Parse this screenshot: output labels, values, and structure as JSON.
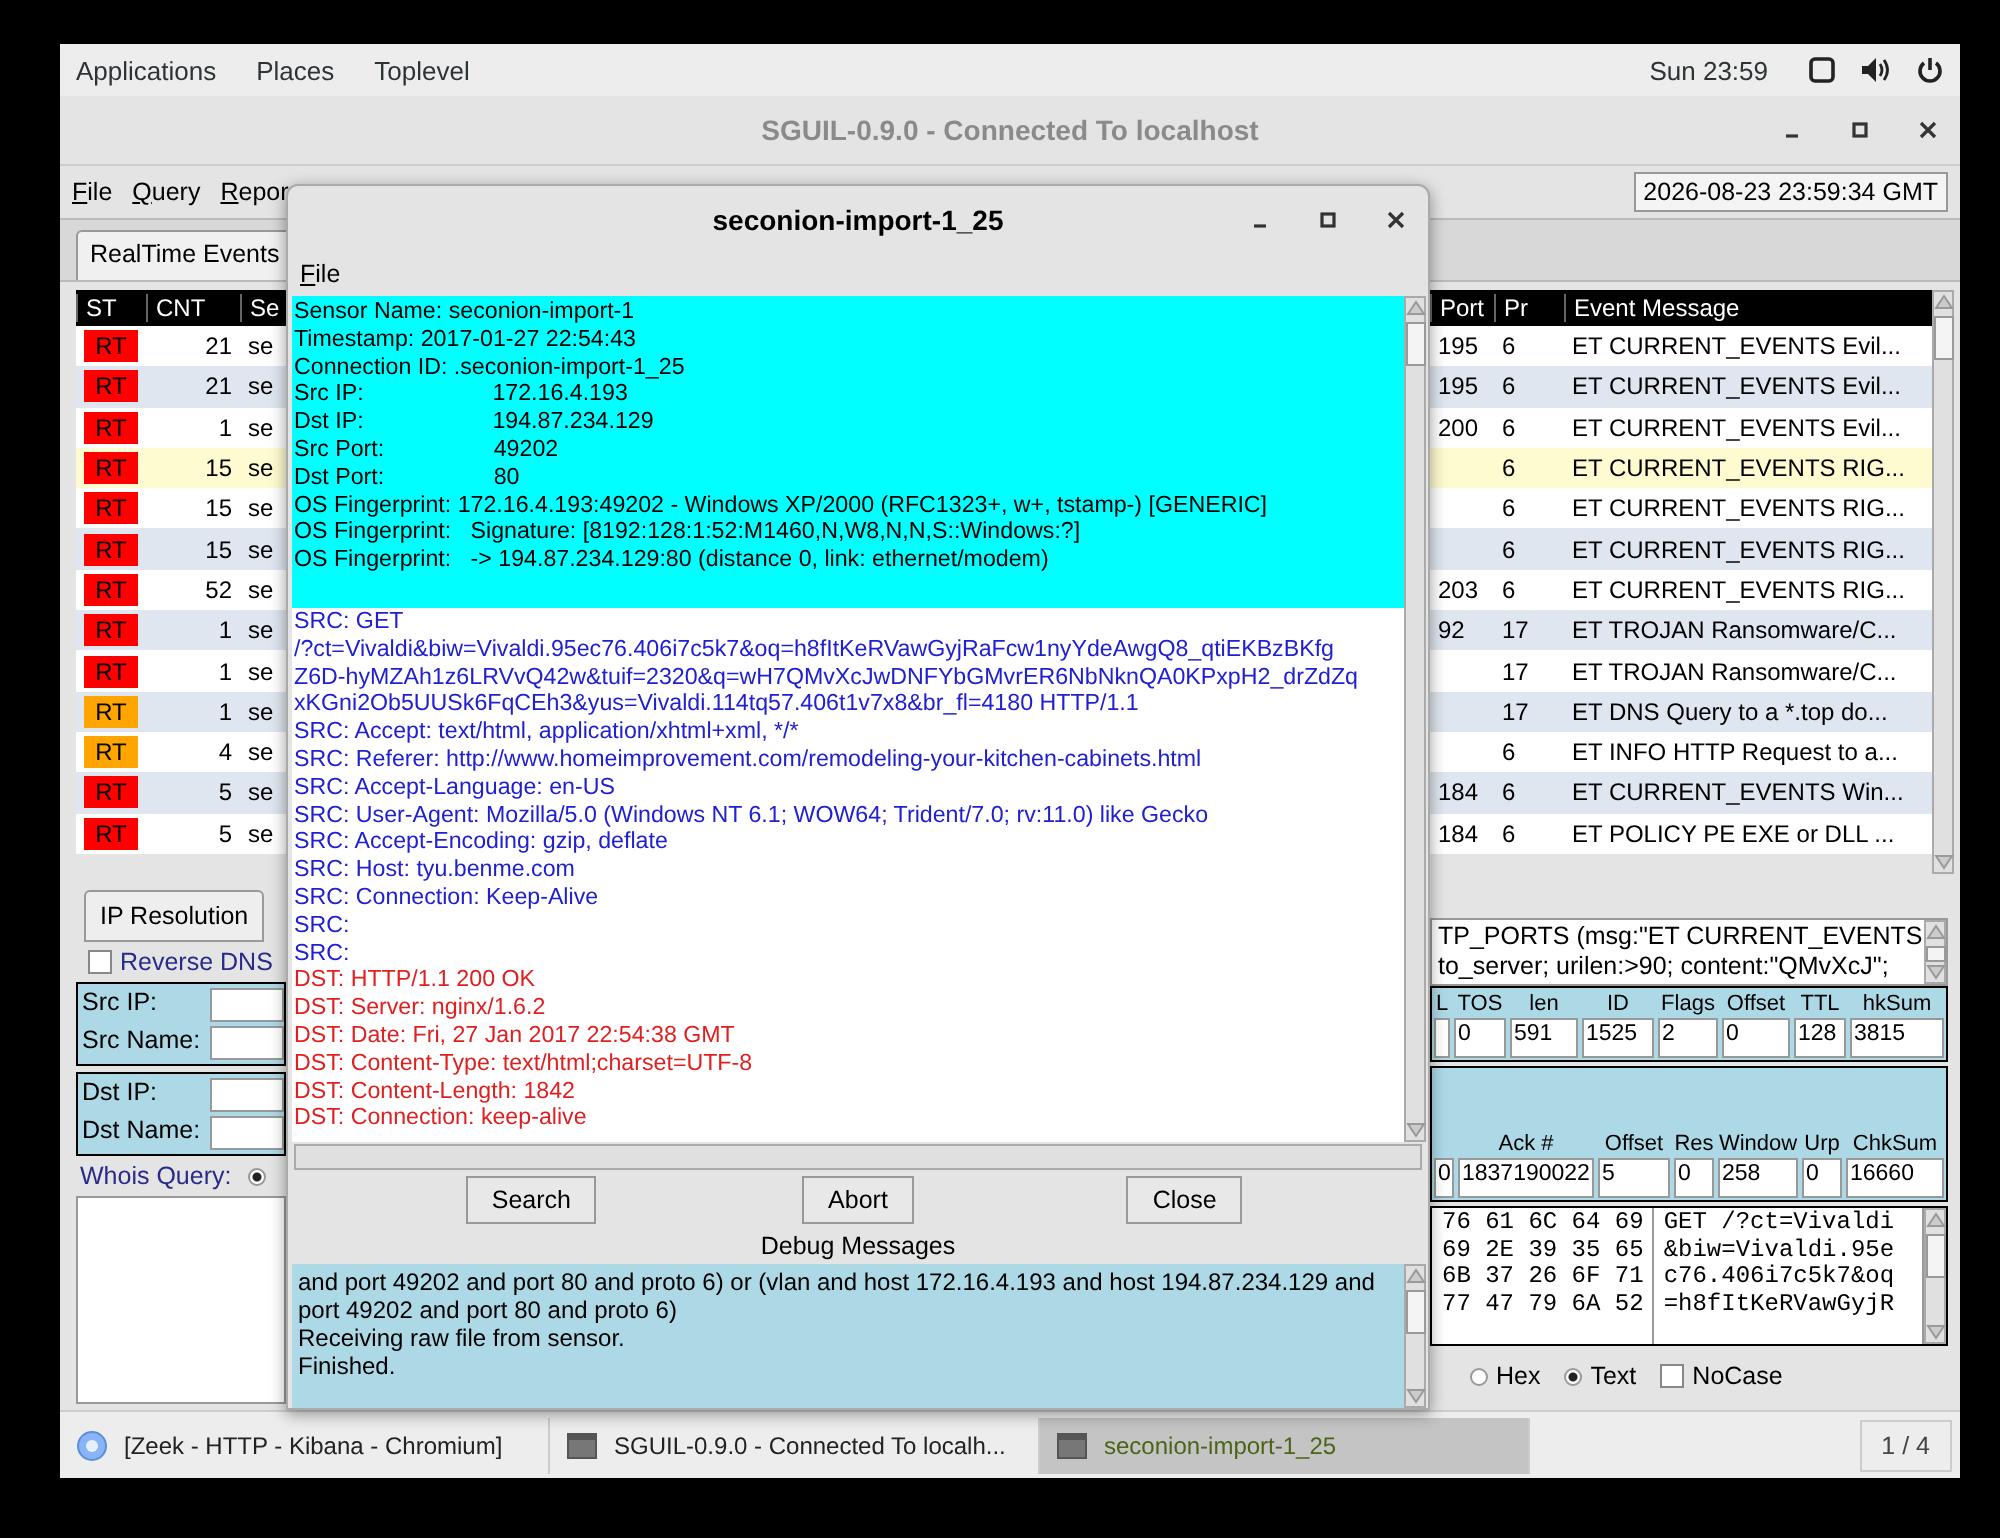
{
  "top_bar": {
    "menus": [
      "Applications",
      "Places",
      "Toplevel"
    ],
    "clock": "Sun 23:59"
  },
  "main_window": {
    "title": "SGUIL-0.9.0 - Connected To localhost",
    "menus": [
      "File",
      "Query",
      "Repor"
    ],
    "datetime": "2026-08-23 23:59:34 GMT",
    "tabs": [
      {
        "label": "RealTime Events",
        "selected": true
      }
    ],
    "events": {
      "left_columns": [
        "ST",
        "CNT",
        "Se"
      ],
      "right_columns": [
        "Port",
        "Pr",
        "Event Message"
      ],
      "rows": [
        {
          "status": "RT",
          "color": "#ff0000",
          "cnt": "21",
          "sensor": "se",
          "port": "195",
          "proto": "6",
          "message": "ET CURRENT_EVENTS Evil...",
          "selected": false
        },
        {
          "status": "RT",
          "color": "#ff0000",
          "cnt": "21",
          "sensor": "se",
          "port": "195",
          "proto": "6",
          "message": "ET CURRENT_EVENTS Evil...",
          "selected": false
        },
        {
          "status": "RT",
          "color": "#ff0000",
          "cnt": "1",
          "sensor": "se",
          "port": "200",
          "proto": "6",
          "message": "ET CURRENT_EVENTS Evil...",
          "selected": false
        },
        {
          "status": "RT",
          "color": "#ff0000",
          "cnt": "15",
          "sensor": "se",
          "proto": "6",
          "message": "ET CURRENT_EVENTS RIG...",
          "selected": true
        },
        {
          "status": "RT",
          "color": "#ff0000",
          "cnt": "15",
          "sensor": "se",
          "proto": "6",
          "message": "ET CURRENT_EVENTS RIG...",
          "selected": false
        },
        {
          "status": "RT",
          "color": "#ff0000",
          "cnt": "15",
          "sensor": "se",
          "proto": "6",
          "message": "ET CURRENT_EVENTS RIG...",
          "selected": false
        },
        {
          "status": "RT",
          "color": "#ff0000",
          "cnt": "52",
          "sensor": "se",
          "port": "203",
          "proto": "6",
          "message": "ET CURRENT_EVENTS RIG...",
          "selected": false
        },
        {
          "status": "RT",
          "color": "#ff0000",
          "cnt": "1",
          "sensor": "se",
          "port": "92",
          "proto": "17",
          "message": "ET TROJAN Ransomware/C...",
          "selected": false
        },
        {
          "status": "RT",
          "color": "#ff0000",
          "cnt": "1",
          "sensor": "se",
          "proto": "17",
          "message": "ET TROJAN Ransomware/C...",
          "selected": false
        },
        {
          "status": "RT",
          "color": "#ffa500",
          "cnt": "1",
          "sensor": "se",
          "proto": "17",
          "message": "ET DNS Query to a *.top do...",
          "selected": false
        },
        {
          "status": "RT",
          "color": "#ffa500",
          "cnt": "4",
          "sensor": "se",
          "proto": "6",
          "message": "ET INFO HTTP Request to a...",
          "selected": false
        },
        {
          "status": "RT",
          "color": "#ff0000",
          "cnt": "5",
          "sensor": "se",
          "port": "184",
          "proto": "6",
          "message": "ET CURRENT_EVENTS Win...",
          "selected": false
        },
        {
          "status": "RT",
          "color": "#ff0000",
          "cnt": "5",
          "sensor": "se",
          "port": "184",
          "proto": "6",
          "message": "ET POLICY PE EXE or DLL ...",
          "selected": false
        }
      ]
    },
    "ip_resolution": {
      "tab": {
        "label": "IP Resolution",
        "selected": true
      },
      "reverse_dns": {
        "label": "Reverse DNS",
        "checked": false
      },
      "src_fields": [
        "Src IP:",
        "Src Name:"
      ],
      "dst_fields": [
        "Dst IP:",
        "Dst Name:"
      ],
      "whois": {
        "label": "Whois Query:",
        "selected": true
      }
    },
    "packet": {
      "rule_lines": [
        "TP_PORTS (msg:\"ET CURRENT_EVENTS",
        "to_server; urilen:>90; content:\"QMvXcJ\";"
      ],
      "ip_header": [
        {
          "label": "L"
        },
        {
          "label": "TOS",
          "value": "0"
        },
        {
          "label": "len",
          "value": "591"
        },
        {
          "label": "ID",
          "value": "1525"
        },
        {
          "label": "Flags",
          "value": "2"
        },
        {
          "label": "Offset",
          "value": "0"
        },
        {
          "label": "TTL",
          "value": "128"
        },
        {
          "label": "hkSum",
          "value": "3815"
        }
      ],
      "tcp_header": [
        {
          "value": "0"
        },
        {
          "label": "Ack #",
          "value": "1837190022"
        },
        {
          "label": "Offset",
          "value": "5"
        },
        {
          "label": "Res",
          "value": "0"
        },
        {
          "label": "Window",
          "value": "258"
        },
        {
          "label": "Urp",
          "value": "0"
        },
        {
          "label": "ChkSum",
          "value": "16660"
        }
      ],
      "hex_lines": [
        "76 61 6C 64 69",
        "69 2E 39 35 65",
        "6B 37 26 6F 71",
        "77 47 79 6A 52"
      ],
      "text_lines": [
        "GET /?ct=Vivaldi",
        "&biw=Vivaldi.95e",
        "c76.406i7c5k7&oq",
        "=h8fItKeRVawGyjR"
      ],
      "display_options": [
        {
          "kind": "radio",
          "label": "Hex",
          "selected": false
        },
        {
          "kind": "radio",
          "label": "Text",
          "selected": true
        },
        {
          "kind": "checkbox",
          "label": "NoCase",
          "checked": false
        }
      ]
    }
  },
  "dialog": {
    "title": "seconion-import-1_25",
    "menus": [
      "File"
    ],
    "header_lines": [
      "Sensor Name: seconion-import-1",
      "Timestamp: 2017-01-27 22:54:43",
      "Connection ID: .seconion-import-1_25",
      "Src IP:                    172.16.4.193",
      "Dst IP:                    194.87.234.129",
      "Src Port:                 49202",
      "Dst Port:                 80",
      "OS Fingerprint: 172.16.4.193:49202 - Windows XP/2000 (RFC1323+, w+, tstamp-) [GENERIC]",
      "OS Fingerprint:   Signature: [8192:128:1:52:M1460,N,W8,N,N,S::Windows:?]",
      "OS Fingerprint:   -> 194.87.234.129:80 (distance 0, link: ethernet/modem)"
    ],
    "lines": [
      {
        "kind": "src",
        "text": "SRC: GET"
      },
      {
        "kind": "src",
        "text": "/?ct=Vivaldi&biw=Vivaldi.95ec76.406i7c5k7&oq=h8fItKeRVawGyjRaFcw1nyYdeAwgQ8_qtiEKBzBKfg"
      },
      {
        "kind": "src",
        "text": "Z6D-hyMZAh1z6LRVvQ42w&tuif=2320&q=wH7QMvXcJwDNFYbGMvrER6NbNknQA0KPxpH2_drZdZq"
      },
      {
        "kind": "src",
        "text": "xKGni2Ob5UUSk6FqCEh3&yus=Vivaldi.114tq57.406t1v7x8&br_fl=4180 HTTP/1.1"
      },
      {
        "kind": "src",
        "text": "SRC: Accept: text/html, application/xhtml+xml, */*"
      },
      {
        "kind": "src",
        "text": "SRC: Referer: http://www.homeimprovement.com/remodeling-your-kitchen-cabinets.html"
      },
      {
        "kind": "src",
        "text": "SRC: Accept-Language: en-US"
      },
      {
        "kind": "src",
        "text": "SRC: User-Agent: Mozilla/5.0 (Windows NT 6.1; WOW64; Trident/7.0; rv:11.0) like Gecko"
      },
      {
        "kind": "src",
        "text": "SRC: Accept-Encoding: gzip, deflate"
      },
      {
        "kind": "src",
        "text": "SRC: Host: tyu.benme.com"
      },
      {
        "kind": "src",
        "text": "SRC: Connection: Keep-Alive"
      },
      {
        "kind": "src",
        "text": "SRC:"
      },
      {
        "kind": "src",
        "text": "SRC:"
      },
      {
        "kind": "dst",
        "text": "DST: HTTP/1.1 200 OK"
      },
      {
        "kind": "dst",
        "text": "DST: Server: nginx/1.6.2"
      },
      {
        "kind": "dst",
        "text": "DST: Date: Fri, 27 Jan 2017 22:54:38 GMT"
      },
      {
        "kind": "dst",
        "text": "DST: Content-Type: text/html;charset=UTF-8"
      },
      {
        "kind": "dst",
        "text": "DST: Content-Length: 1842"
      },
      {
        "kind": "dst",
        "text": "DST: Connection: keep-alive"
      }
    ],
    "buttons": [
      "Search",
      "Abort",
      "Close"
    ],
    "debug_label": "Debug Messages",
    "debug_lines": [
      "and port 49202 and port 80 and proto 6) or (vlan and host 172.16.4.193 and host 194.87.234.129 and",
      "port 49202 and port 80 and proto 6)",
      "Receiving raw file from sensor.",
      "Finished."
    ]
  },
  "taskbar": {
    "items": [
      {
        "kind": "browser",
        "label": "[Zeek - HTTP - Kibana - Chromium]",
        "selected": false
      },
      {
        "kind": "window",
        "label": "SGUIL-0.9.0 - Connected To localh...",
        "selected": false
      },
      {
        "kind": "window",
        "label": "seconion-import-1_25",
        "selected": true
      }
    ],
    "pager": "1 / 4"
  }
}
